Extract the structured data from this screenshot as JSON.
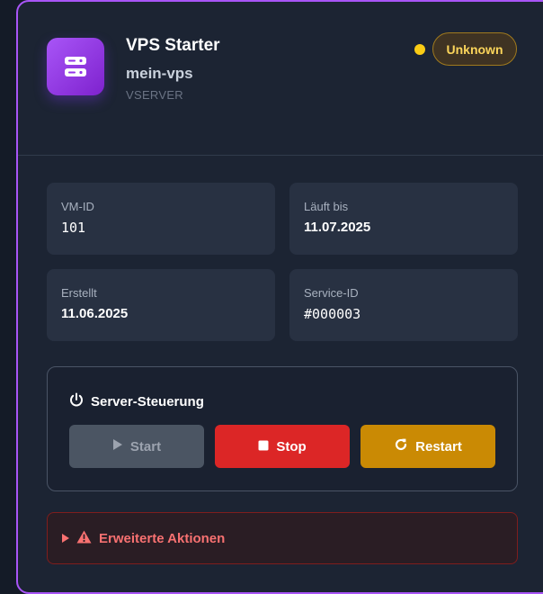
{
  "service": {
    "title": "VPS Starter",
    "hostname": "mein-vps",
    "type": "VSERVER",
    "status": "Unknown",
    "status_color": "#facc15",
    "icon": "server-icon",
    "accent": "#a855f7"
  },
  "info": {
    "vmid_label": "VM-ID",
    "vmid_value": "101",
    "expires_label": "Läuft bis",
    "expires_value": "11.07.2025",
    "created_label": "Erstellt",
    "created_value": "11.06.2025",
    "serviceid_label": "Service-ID",
    "serviceid_value": "#000003"
  },
  "controls": {
    "title": "Server-Steuerung",
    "title_icon": "power-icon",
    "start_label": "Start",
    "start_icon": "play-icon",
    "stop_label": "Stop",
    "stop_icon": "stop-icon",
    "restart_label": "Restart",
    "restart_icon": "restart-icon",
    "start_color": "#4b5563",
    "stop_color": "#dc2626",
    "restart_color": "#ca8a04"
  },
  "advanced": {
    "label": "Erweiterte Aktionen",
    "icon": "warning-icon",
    "color": "#f87171"
  }
}
